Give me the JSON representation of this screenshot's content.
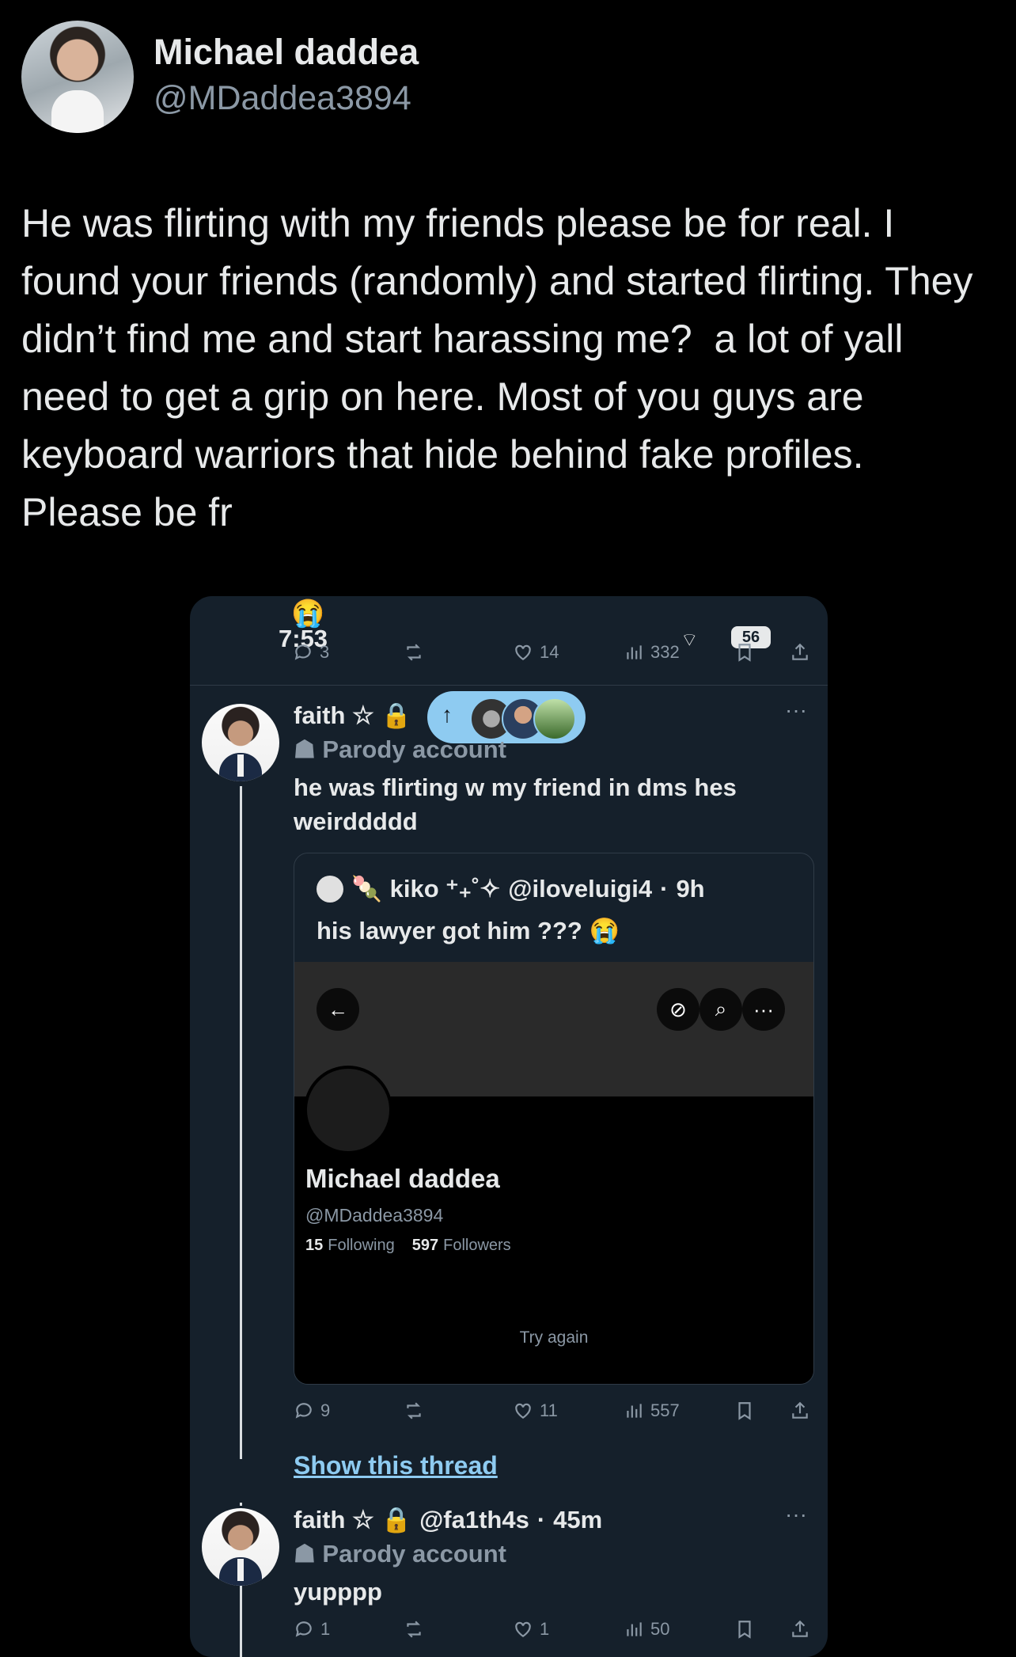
{
  "tweet": {
    "author_name": "Michael daddea",
    "author_handle": "@MDaddea3894",
    "text": "He was flirting with my friends please be for real. I found your friends (randomly) and started flirting. They didn’t find me and start harassing me?  a lot of yall need to get a grip on here. Most of you guys are keyboard warriors that hide behind fake profiles. Please be fr"
  },
  "screenshot": {
    "status_time": "7:53",
    "status_battery": "56",
    "top_emoji": "😭",
    "top_stats": {
      "replies": "3",
      "likes": "14",
      "views": "332"
    },
    "post1": {
      "name": "faith ☆ 🔒",
      "parody_label": "Parody account",
      "text": "he was flirting w my friend in dms hes weirddddd"
    },
    "quote": {
      "name": "kiko ⁺₊˚✧",
      "handle": "@iloveluigi4",
      "time": "9h",
      "text": "his lawyer got him ??? 😭",
      "profile_name": "Michael daddea",
      "profile_handle": "@MDaddea3894",
      "following_count": "15",
      "following_label": "Following",
      "followers_count": "597",
      "followers_label": "Followers",
      "try_again": "Try again"
    },
    "post1_stats": {
      "replies": "9",
      "likes": "11",
      "views": "557"
    },
    "show_thread": "Show this thread",
    "post2": {
      "name": "faith ☆ 🔒",
      "handle": "@fa1th4s",
      "time": "45m",
      "parody_label": "Parody account",
      "text": "yupppp"
    },
    "post2_stats": {
      "replies": "1",
      "likes": "1",
      "views": "50"
    },
    "more_icon": "more-icon",
    "back_icon": "arrow-left-icon"
  },
  "colors": {
    "background": "#000000",
    "embed_bg": "#15202b",
    "link": "#8ecbf1",
    "muted": "#8b98a5"
  }
}
